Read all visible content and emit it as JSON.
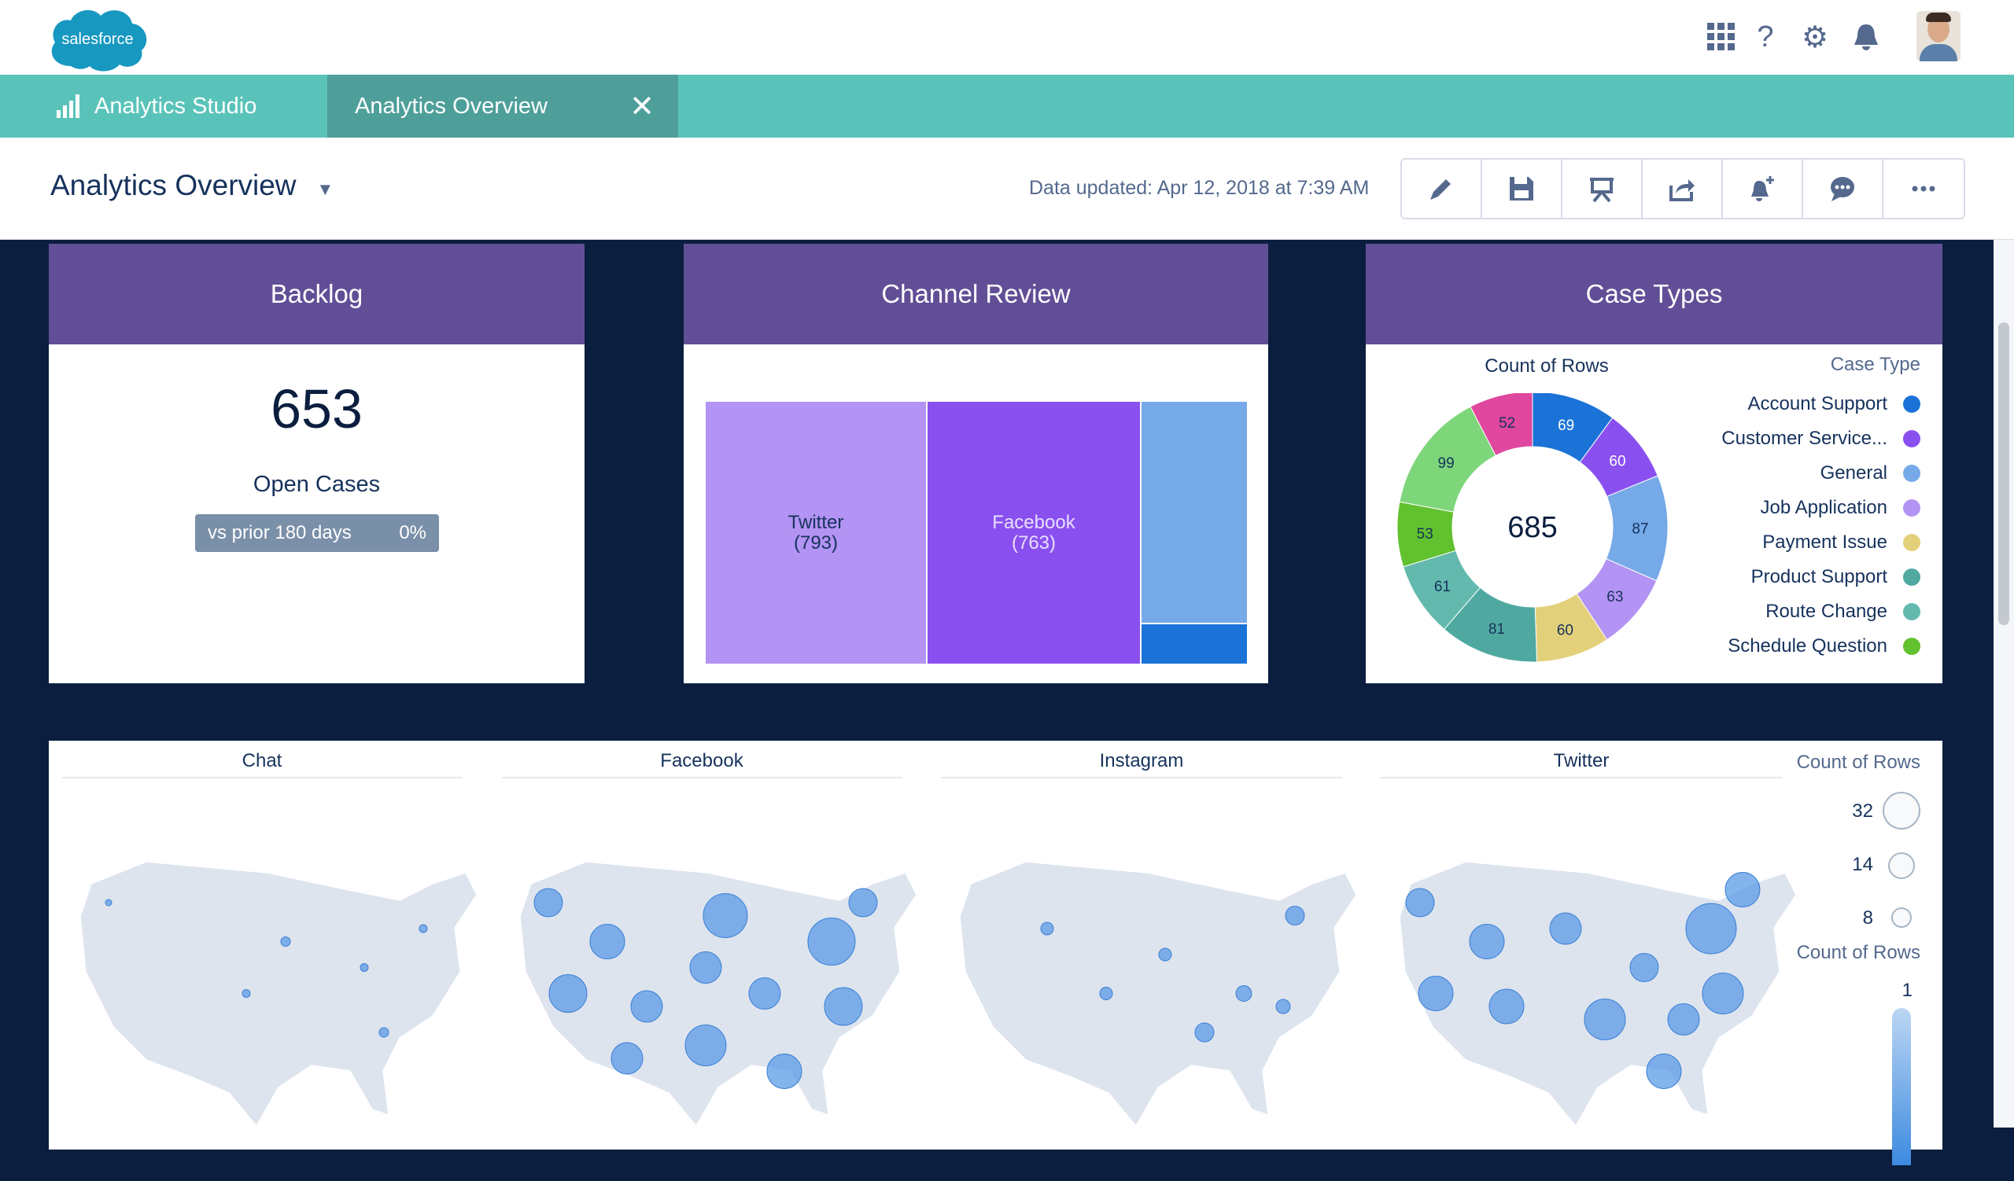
{
  "header": {
    "logo_text": "salesforce",
    "icons": [
      "app-launcher-icon",
      "help-icon",
      "setup-gear-icon",
      "notifications-bell-icon",
      "user-avatar"
    ]
  },
  "tabs": {
    "app_name": "Analytics Studio",
    "active_tab": "Analytics Overview"
  },
  "page": {
    "title": "Analytics Overview",
    "updated": "Data updated: Apr 12, 2018 at 7:39 AM",
    "toolbar": [
      "edit-pencil-icon",
      "save-icon",
      "present-icon",
      "share-icon",
      "notify-icon",
      "comment-icon",
      "more-icon"
    ]
  },
  "backlog": {
    "title": "Backlog",
    "value": "653",
    "label": "Open Cases",
    "compare": "vs prior 180 days",
    "change": "0%"
  },
  "channel": {
    "title": "Channel Review",
    "chart_data": {
      "type": "treemap",
      "items": [
        {
          "label": "Twitter",
          "value": 793,
          "color": "#b393f3"
        },
        {
          "label": "Facebook",
          "value": 763,
          "color": "#8a50ef"
        },
        {
          "label": "",
          "value": 220,
          "color": "#75a9e7"
        },
        {
          "label": "",
          "value": 40,
          "color": "#1b73d8"
        }
      ]
    }
  },
  "case_types": {
    "title": "Case Types",
    "chart_data": {
      "type": "pie",
      "title": "Count of Rows",
      "total": "685",
      "legend_title": "Case Type",
      "slices": [
        {
          "name": "Account Support",
          "value": 69,
          "color": "#1b73d8"
        },
        {
          "name": "Customer Service...",
          "value": 60,
          "color": "#8a50ef"
        },
        {
          "name": "General",
          "value": 87,
          "color": "#75a9e7"
        },
        {
          "name": "Job Application",
          "value": 63,
          "color": "#b393f3"
        },
        {
          "name": "Payment Issue",
          "value": 60,
          "color": "#e3d07a"
        },
        {
          "name": "Product Support",
          "value": 81,
          "color": "#4fa9a1"
        },
        {
          "name": "Route Change",
          "value": 61,
          "color": "#63b9ad"
        },
        {
          "name": "Schedule Question",
          "value": 53,
          "color": "#62c12e"
        },
        {
          "name": "",
          "value": 99,
          "color": "#7ed67a"
        },
        {
          "name": "",
          "value": 52,
          "color": "#e0479e"
        }
      ]
    }
  },
  "maps": {
    "panels": [
      "Chat",
      "Facebook",
      "Instagram",
      "Twitter"
    ],
    "size_legend_title": "Count of Rows",
    "size_legend": [
      "32",
      "14",
      "8"
    ],
    "color_legend_title": "Count of Rows",
    "color_legend_top": "1"
  }
}
